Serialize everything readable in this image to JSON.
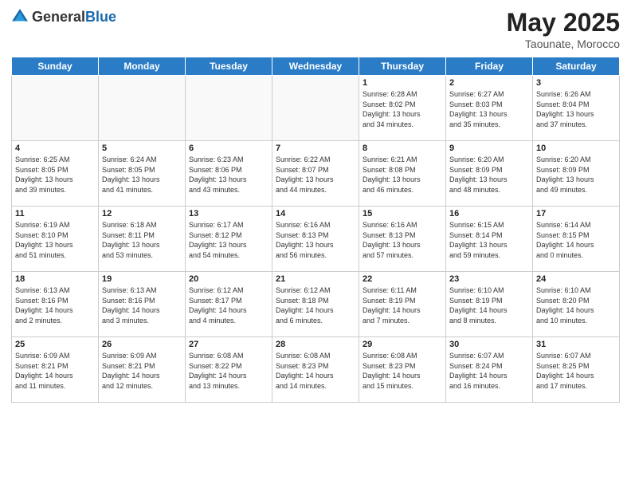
{
  "header": {
    "logo_general": "General",
    "logo_blue": "Blue",
    "title": "May 2025",
    "location": "Taounate, Morocco"
  },
  "days_of_week": [
    "Sunday",
    "Monday",
    "Tuesday",
    "Wednesday",
    "Thursday",
    "Friday",
    "Saturday"
  ],
  "weeks": [
    [
      {
        "day": "",
        "info": ""
      },
      {
        "day": "",
        "info": ""
      },
      {
        "day": "",
        "info": ""
      },
      {
        "day": "",
        "info": ""
      },
      {
        "day": "1",
        "info": "Sunrise: 6:28 AM\nSunset: 8:02 PM\nDaylight: 13 hours\nand 34 minutes."
      },
      {
        "day": "2",
        "info": "Sunrise: 6:27 AM\nSunset: 8:03 PM\nDaylight: 13 hours\nand 35 minutes."
      },
      {
        "day": "3",
        "info": "Sunrise: 6:26 AM\nSunset: 8:04 PM\nDaylight: 13 hours\nand 37 minutes."
      }
    ],
    [
      {
        "day": "4",
        "info": "Sunrise: 6:25 AM\nSunset: 8:05 PM\nDaylight: 13 hours\nand 39 minutes."
      },
      {
        "day": "5",
        "info": "Sunrise: 6:24 AM\nSunset: 8:05 PM\nDaylight: 13 hours\nand 41 minutes."
      },
      {
        "day": "6",
        "info": "Sunrise: 6:23 AM\nSunset: 8:06 PM\nDaylight: 13 hours\nand 43 minutes."
      },
      {
        "day": "7",
        "info": "Sunrise: 6:22 AM\nSunset: 8:07 PM\nDaylight: 13 hours\nand 44 minutes."
      },
      {
        "day": "8",
        "info": "Sunrise: 6:21 AM\nSunset: 8:08 PM\nDaylight: 13 hours\nand 46 minutes."
      },
      {
        "day": "9",
        "info": "Sunrise: 6:20 AM\nSunset: 8:09 PM\nDaylight: 13 hours\nand 48 minutes."
      },
      {
        "day": "10",
        "info": "Sunrise: 6:20 AM\nSunset: 8:09 PM\nDaylight: 13 hours\nand 49 minutes."
      }
    ],
    [
      {
        "day": "11",
        "info": "Sunrise: 6:19 AM\nSunset: 8:10 PM\nDaylight: 13 hours\nand 51 minutes."
      },
      {
        "day": "12",
        "info": "Sunrise: 6:18 AM\nSunset: 8:11 PM\nDaylight: 13 hours\nand 53 minutes."
      },
      {
        "day": "13",
        "info": "Sunrise: 6:17 AM\nSunset: 8:12 PM\nDaylight: 13 hours\nand 54 minutes."
      },
      {
        "day": "14",
        "info": "Sunrise: 6:16 AM\nSunset: 8:13 PM\nDaylight: 13 hours\nand 56 minutes."
      },
      {
        "day": "15",
        "info": "Sunrise: 6:16 AM\nSunset: 8:13 PM\nDaylight: 13 hours\nand 57 minutes."
      },
      {
        "day": "16",
        "info": "Sunrise: 6:15 AM\nSunset: 8:14 PM\nDaylight: 13 hours\nand 59 minutes."
      },
      {
        "day": "17",
        "info": "Sunrise: 6:14 AM\nSunset: 8:15 PM\nDaylight: 14 hours\nand 0 minutes."
      }
    ],
    [
      {
        "day": "18",
        "info": "Sunrise: 6:13 AM\nSunset: 8:16 PM\nDaylight: 14 hours\nand 2 minutes."
      },
      {
        "day": "19",
        "info": "Sunrise: 6:13 AM\nSunset: 8:16 PM\nDaylight: 14 hours\nand 3 minutes."
      },
      {
        "day": "20",
        "info": "Sunrise: 6:12 AM\nSunset: 8:17 PM\nDaylight: 14 hours\nand 4 minutes."
      },
      {
        "day": "21",
        "info": "Sunrise: 6:12 AM\nSunset: 8:18 PM\nDaylight: 14 hours\nand 6 minutes."
      },
      {
        "day": "22",
        "info": "Sunrise: 6:11 AM\nSunset: 8:19 PM\nDaylight: 14 hours\nand 7 minutes."
      },
      {
        "day": "23",
        "info": "Sunrise: 6:10 AM\nSunset: 8:19 PM\nDaylight: 14 hours\nand 8 minutes."
      },
      {
        "day": "24",
        "info": "Sunrise: 6:10 AM\nSunset: 8:20 PM\nDaylight: 14 hours\nand 10 minutes."
      }
    ],
    [
      {
        "day": "25",
        "info": "Sunrise: 6:09 AM\nSunset: 8:21 PM\nDaylight: 14 hours\nand 11 minutes."
      },
      {
        "day": "26",
        "info": "Sunrise: 6:09 AM\nSunset: 8:21 PM\nDaylight: 14 hours\nand 12 minutes."
      },
      {
        "day": "27",
        "info": "Sunrise: 6:08 AM\nSunset: 8:22 PM\nDaylight: 14 hours\nand 13 minutes."
      },
      {
        "day": "28",
        "info": "Sunrise: 6:08 AM\nSunset: 8:23 PM\nDaylight: 14 hours\nand 14 minutes."
      },
      {
        "day": "29",
        "info": "Sunrise: 6:08 AM\nSunset: 8:23 PM\nDaylight: 14 hours\nand 15 minutes."
      },
      {
        "day": "30",
        "info": "Sunrise: 6:07 AM\nSunset: 8:24 PM\nDaylight: 14 hours\nand 16 minutes."
      },
      {
        "day": "31",
        "info": "Sunrise: 6:07 AM\nSunset: 8:25 PM\nDaylight: 14 hours\nand 17 minutes."
      }
    ]
  ]
}
